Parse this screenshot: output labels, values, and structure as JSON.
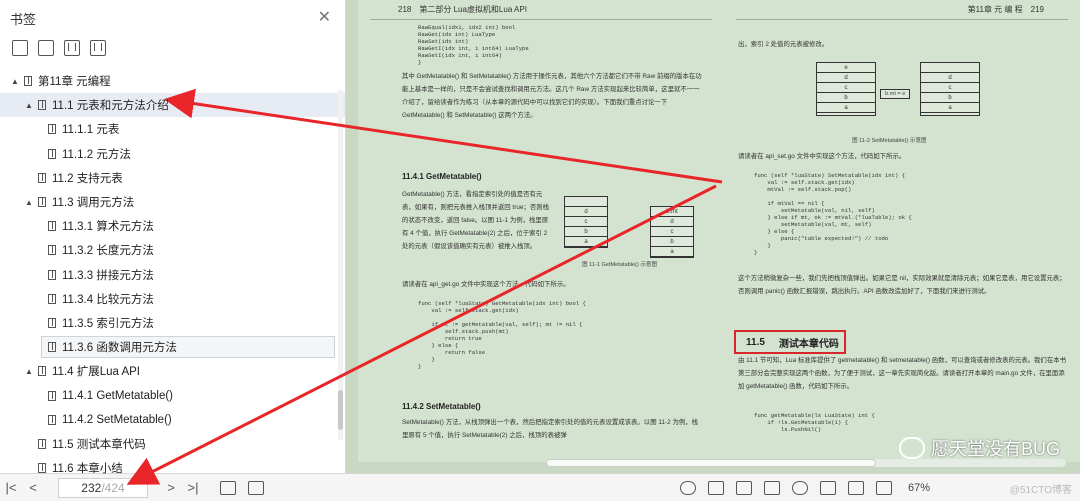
{
  "sidebar": {
    "title": "书签",
    "close_glyph": "✕",
    "toc": [
      {
        "label": "第11章 元编程",
        "level": 0,
        "caret": "▲"
      },
      {
        "label": "11.1 元表和元方法介绍",
        "level": 1,
        "caret": "▲"
      },
      {
        "label": "11.1.1 元表",
        "level": 2
      },
      {
        "label": "11.1.2 元方法",
        "level": 2
      },
      {
        "label": "11.2 支持元表",
        "level": 1
      },
      {
        "label": "11.3 调用元方法",
        "level": 1,
        "caret": "▲"
      },
      {
        "label": "11.3.1 算术元方法",
        "level": 2
      },
      {
        "label": "11.3.2 长度元方法",
        "level": 2
      },
      {
        "label": "11.3.3 拼接元方法",
        "level": 2
      },
      {
        "label": "11.3.4 比较元方法",
        "level": 2
      },
      {
        "label": "11.3.5 索引元方法",
        "level": 2
      },
      {
        "label": "11.3.6 函数调用元方法",
        "level": 2
      },
      {
        "label": "11.4 扩展Lua API",
        "level": 1,
        "caret": "▲"
      },
      {
        "label": "11.4.1 GetMetatable()",
        "level": 2
      },
      {
        "label": "11.4.2 SetMetatable()",
        "level": 2
      },
      {
        "label": "11.5 测试本章代码",
        "level": 1
      },
      {
        "label": "11.6 本章小结",
        "level": 1
      }
    ]
  },
  "document": {
    "left_page": {
      "number": "218",
      "header": "第二部分  Lua虚拟机和Lua API",
      "code_top": "RawEqual(idx1, idx2 int) bool\nRawGet(idx int) LuaType\nRawSet(idx int)\nRawGetI(idx int, i int64) LuaType\nRawSetI(idx int, i int64)\n}",
      "para1": "其中 GetMetatable() 和 SetMetatable() 方法用于操作元表，其他六个方法都它们不带 Raw 前缀的版本在功能上基本是一样的，只是不会尝试查找和调用元方法。这几个 Raw 方法实现起来比较简单，这里就不一一介绍了，留给读者作为练习（从本章的源代码中可以找到它们的实现）。下面我们重点讨论一下 GetMetatable() 和 SetMetatable() 这两个方法。",
      "sec_1141": "11.4.1  GetMetatable()",
      "para2": "GetMetatable() 方法，看指定索引处的值是否有元表，如果有，则把元表推入栈顶并返回 true；否则栈的状态不改变，返回 false。以图 11-1 为例，栈里原有 4 个值，执行 GetMetatable(2) 之后，位于索引 2 处的元表（假设该值确实有元表）被推入栈顶。",
      "fig1_caption": "图 11-1  GetMetatable() 示意图",
      "fig1_left": [
        "",
        "d",
        "c",
        "b",
        "a"
      ],
      "fig1_right": [
        "b.mt",
        "d",
        "c",
        "b",
        "a"
      ],
      "para3": "请读者在 api_get.go 文件中实现这个方法，代码如下所示。",
      "code_get": "func (self *luaState) GetMetatable(idx int) bool {\n    val := self.stack.get(idx)\n\n    if mt := getMetatable(val, self); mt != nil {\n        self.stack.push(mt)\n        return true\n    } else {\n        return false\n    }\n}",
      "sec_1142": "11.4.2  SetMetatable()",
      "para4": "SetMetatable() 方法，从栈顶弹出一个表，然后把指定索引处的值的元表设置成该表。以图 11-2 为例，栈里原有 5 个值，执行 SetMetatable(2) 之后，栈顶的表被弹"
    },
    "right_page": {
      "number": "219",
      "header": "第11章  元 编 程",
      "intro": "出，索引 2 处值的元表被修改。",
      "fig2_caption": "图 11-2  SetMetatable() 示意图",
      "fig2_left": [
        "e",
        "d",
        "c",
        "b",
        "a"
      ],
      "fig2_right": [
        "",
        "d",
        "c",
        "b",
        "a"
      ],
      "fig2_label": "b.mt = e",
      "para1": "请读者在 api_set.go 文件中实现这个方法，代码如下所示。",
      "code_set": "func (self *luaState) SetMetatable(idx int) {\n    val := self.stack.get(idx)\n    mtVal := self.stack.pop()\n\n    if mtVal == nil {\n        setMetatable(val, nil, self)\n    } else if mt, ok := mtVal.(*luaTable); ok {\n        setMetatable(val, mt, self)\n    } else {\n        panic(\"table expected!\") // todo\n    }\n}",
      "para2": "这个方法稍微复杂一些，我们先把栈顶值弹出。如果它是 nil，实际效果就是清除元表；如果它是表，用它设置元表；否则调用 panic() 函数汇报错误，跳出执行。API 函数改造加好了，下面我们来进行测试。",
      "sec_115_num": "11.5",
      "sec_115_title": "测试本章代码",
      "para3": "由 11.1 节可知，Lua 标准库提供了 getmetatable() 和 setmetatable() 函数，可以查询或者修改表的元表。我们在本书第三部分会完整实现这两个函数，为了便于测试，这一章先实现简化版。请读者打开本章的 main.go 文件，在里面添加 getMetatable() 函数，代码如下所示。",
      "code_main": "func getMetatable(ls LuaState) int {\n    if !ls.GetMetatable(1) {\n        ls.PushNil()"
    },
    "watermark": "愿天堂没有BUG"
  },
  "bottombar": {
    "current_page": "232",
    "total_pages": "/424",
    "zoom": "67%",
    "credit": "@51CTO博客"
  }
}
